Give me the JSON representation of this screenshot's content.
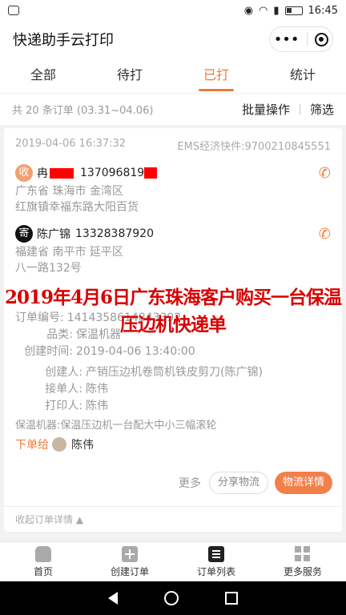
{
  "status": {
    "time": "16:45"
  },
  "app": {
    "title": "快递助手云打印",
    "more": "•••"
  },
  "tabs": [
    "全部",
    "待打",
    "已打",
    "统计"
  ],
  "summary": {
    "count": "共 20 条订单 (03.31~04.06)",
    "batch": "批量操作",
    "filter": "筛选"
  },
  "order": {
    "datetime": "2019-04-06 16:37:32",
    "express": "EMS经济快件:9700210845551",
    "receiver": {
      "badge": "收",
      "name": "冉",
      "phone": "137096819",
      "addr1": "广东省 珠海市 金湾区",
      "addr2": "红旗镇幸福东路大阳百货"
    },
    "sender": {
      "badge": "寄",
      "name": "陈广锦",
      "phone": "13328387920",
      "addr1": "福建省 南平市 延平区",
      "addr2": "八一路132号"
    },
    "overlay": "2019年4月6日广东珠海客户购买一台保温压边机快递单",
    "fields": [
      {
        "k": "订单编号:",
        "v": "1414358614843392"
      },
      {
        "k": "品类:",
        "v": "保温机器"
      },
      {
        "k": "创建时间:",
        "v": "2019-04-06 13:40:00"
      }
    ],
    "people": [
      {
        "k": "创建人:",
        "v": "产销压边机卷筒机铁皮剪刀(陈广锦)"
      },
      {
        "k": "接单人:",
        "v": "陈伟"
      },
      {
        "k": "打印人:",
        "v": "陈伟"
      }
    ],
    "desc": "保温机器:保温压边机一台配大中小三幅滚轮",
    "order_to_label": "下单给",
    "order_to_name": "陈伟",
    "btn_more": "更多",
    "btn_share": "分享物流",
    "btn_logistics": "物流详情",
    "collapse": "收起订单详情 ▲"
  },
  "bottomnav": [
    "首页",
    "创建订单",
    "订单列表",
    "更多服务"
  ],
  "colors": {
    "accent": "#f07a3a",
    "overlay": "#d90000"
  }
}
